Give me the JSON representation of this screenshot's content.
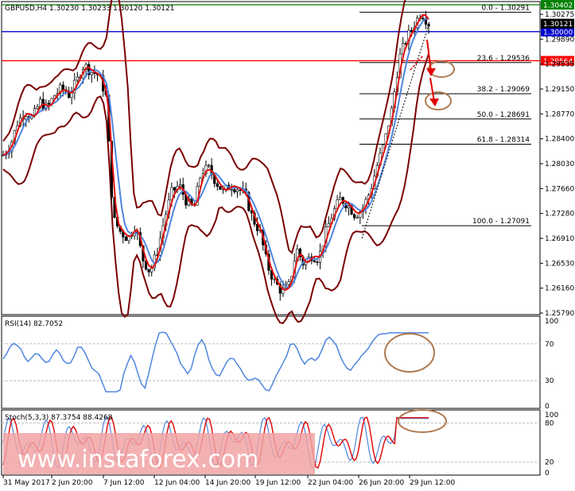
{
  "chart_data": {
    "type": "candlestick",
    "header": "GBPUSD,H4  1.30230 1.30233 1.30120 1.30121",
    "price_ylim": [
      1.2576,
      1.3045
    ],
    "price_ticks": [
      "1.30275",
      "1.29890",
      "1.29535",
      "1.29150",
      "1.28770",
      "1.28400",
      "1.28030",
      "1.27660",
      "1.27280",
      "1.26910",
      "1.26530",
      "1.26160",
      "1.25790"
    ],
    "x_labels": [
      "31 May 2017",
      "2 Jun 20:00",
      "7 Jun 12:00",
      "12 Jun 04:00",
      "14 Jun 20:00",
      "19 Jun 12:00",
      "22 Jun 04:00",
      "26 Jun 20:00",
      "29 Jun 12:00"
    ],
    "h_lines": [
      {
        "price": 1.30402,
        "label": "1.30402",
        "color": "#008000"
      },
      {
        "price": 1.3,
        "label": "1.30000",
        "color": "#0000cc"
      },
      {
        "price": 1.29564,
        "label": "1.29564",
        "color": "#ff0000"
      }
    ],
    "current_price": "1.30121",
    "fib_levels": [
      {
        "price": 1.30291,
        "label": "0.0 - 1.30291"
      },
      {
        "price": 1.29536,
        "label": "23.6 - 1.29536"
      },
      {
        "price": 1.29069,
        "label": "38.2 - 1.29069"
      },
      {
        "price": 1.28691,
        "label": "50.0 - 1.28691"
      },
      {
        "price": 1.28314,
        "label": "61.8 - 1.28314"
      },
      {
        "price": 1.27091,
        "label": "100.0 - 1.27091"
      }
    ],
    "rsi": {
      "label": "RSI(14) 82.7052",
      "ticks": [
        "100",
        "70",
        "30",
        "0"
      ],
      "levels": [
        70,
        30
      ]
    },
    "stoch": {
      "label": "Stoch(5,3,3) 87.3754 88.4268",
      "ticks": [
        "100",
        "80",
        "20",
        "0"
      ],
      "levels": [
        80,
        20
      ]
    },
    "price_path": [
      1.2815,
      1.283,
      1.2865,
      1.288,
      1.287,
      1.2895,
      1.2885,
      1.2905,
      1.2915,
      1.2905,
      1.2925,
      1.295,
      1.294,
      1.2935,
      1.2905,
      1.272,
      1.27,
      1.269,
      1.271,
      1.266,
      1.264,
      1.267,
      1.272,
      1.276,
      1.277,
      1.2745,
      1.2735,
      1.279,
      1.2795,
      1.2775,
      1.276,
      1.277,
      1.2765,
      1.2755,
      1.272,
      1.27,
      1.265,
      1.2625,
      1.261,
      1.262,
      1.2675,
      1.265,
      1.2665,
      1.266,
      1.27,
      1.273,
      1.275,
      1.274,
      1.2725,
      1.2735,
      1.276,
      1.28,
      1.2835,
      1.2885,
      1.296,
      1.299,
      1.301,
      1.303,
      1.3012
    ]
  },
  "watermark": "www.instaforex.com"
}
